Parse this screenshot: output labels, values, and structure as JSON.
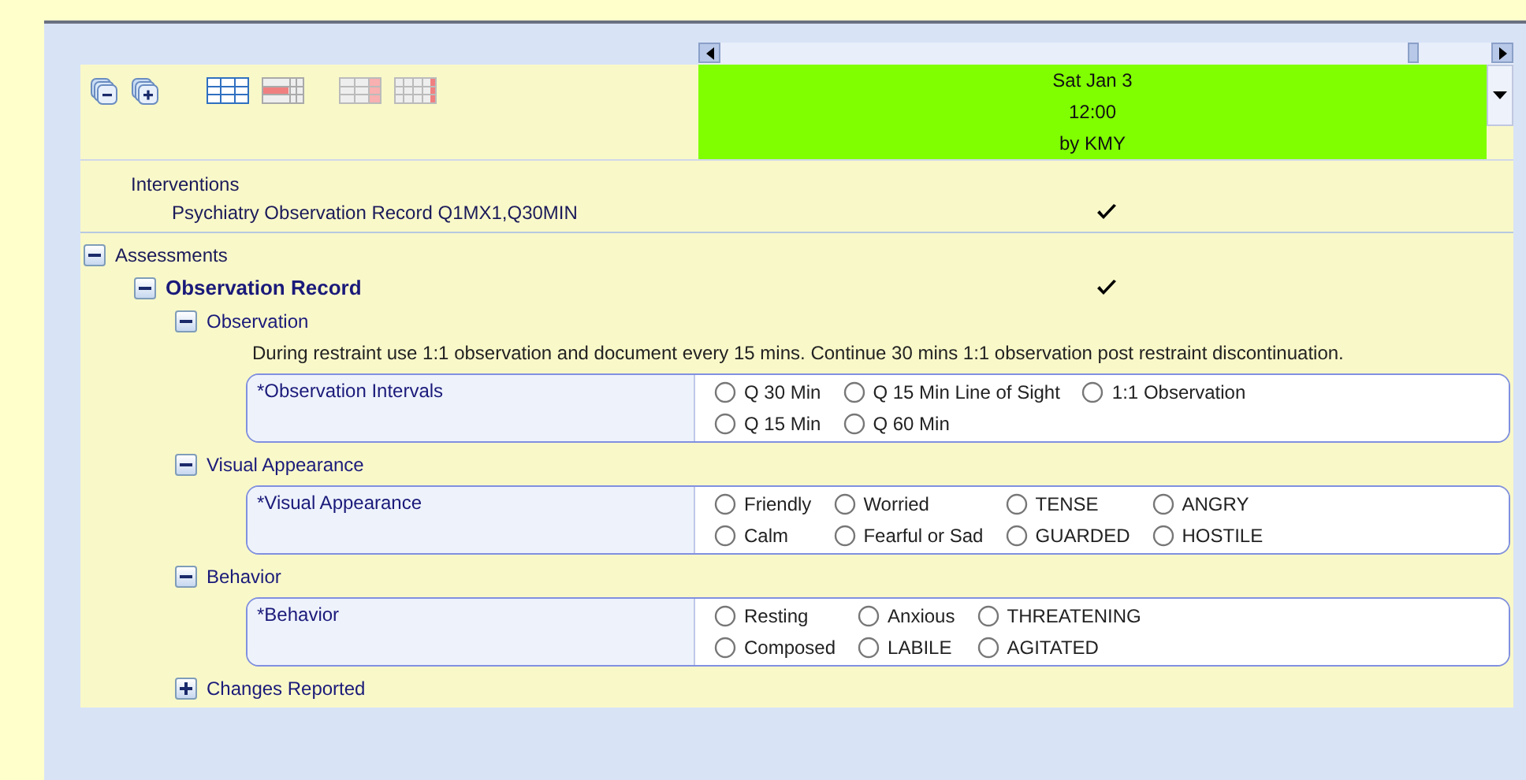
{
  "column_header": {
    "date": "Sat Jan 3",
    "time": "12:00",
    "author": "by KMY"
  },
  "interventions": {
    "label": "Interventions",
    "items": [
      {
        "label": "Psychiatry Observation Record Q1MX1,Q30MIN",
        "charted": true
      }
    ]
  },
  "assessments": {
    "label": "Assessments",
    "expanded": true,
    "children": [
      {
        "label": "Observation Record",
        "expanded": true,
        "charted": true,
        "children": [
          {
            "kind": "section",
            "label": "Observation",
            "expanded": true,
            "children": [
              {
                "kind": "note",
                "text": "During restraint use 1:1 observation and document every 15 mins. Continue 30 mins 1:1 observation post restraint discontinuation."
              },
              {
                "kind": "question",
                "label": "*Observation Intervals",
                "options": [
                  {
                    "label": "Q 30 Min",
                    "selected": false
                  },
                  {
                    "label": "Q 15 Min Line of Sight",
                    "selected": false
                  },
                  {
                    "label": "1:1 Observation",
                    "selected": false
                  },
                  {
                    "label": "Q 15 Min",
                    "selected": false
                  },
                  {
                    "label": "Q 60 Min",
                    "selected": false
                  }
                ]
              }
            ]
          },
          {
            "kind": "section",
            "label": "Visual Appearance",
            "expanded": true,
            "children": [
              {
                "kind": "question",
                "label": "*Visual Appearance",
                "options": [
                  {
                    "label": "Friendly",
                    "selected": false
                  },
                  {
                    "label": "Worried",
                    "selected": false
                  },
                  {
                    "label": "TENSE",
                    "selected": false
                  },
                  {
                    "label": "ANGRY",
                    "selected": false
                  },
                  {
                    "label": "Calm",
                    "selected": false
                  },
                  {
                    "label": "Fearful or Sad",
                    "selected": false
                  },
                  {
                    "label": "GUARDED",
                    "selected": false
                  },
                  {
                    "label": "HOSTILE",
                    "selected": false
                  }
                ]
              }
            ]
          },
          {
            "kind": "section",
            "label": "Behavior",
            "expanded": true,
            "children": [
              {
                "kind": "question",
                "label": "*Behavior",
                "options": [
                  {
                    "label": "Resting",
                    "selected": false
                  },
                  {
                    "label": "Anxious",
                    "selected": false
                  },
                  {
                    "label": "THREATENING",
                    "selected": false
                  },
                  {
                    "label": "Composed",
                    "selected": false
                  },
                  {
                    "label": "LABILE",
                    "selected": false
                  },
                  {
                    "label": "AGITATED",
                    "selected": false
                  }
                ]
              }
            ]
          },
          {
            "kind": "section",
            "label": "Changes Reported",
            "expanded": false
          }
        ]
      }
    ]
  }
}
